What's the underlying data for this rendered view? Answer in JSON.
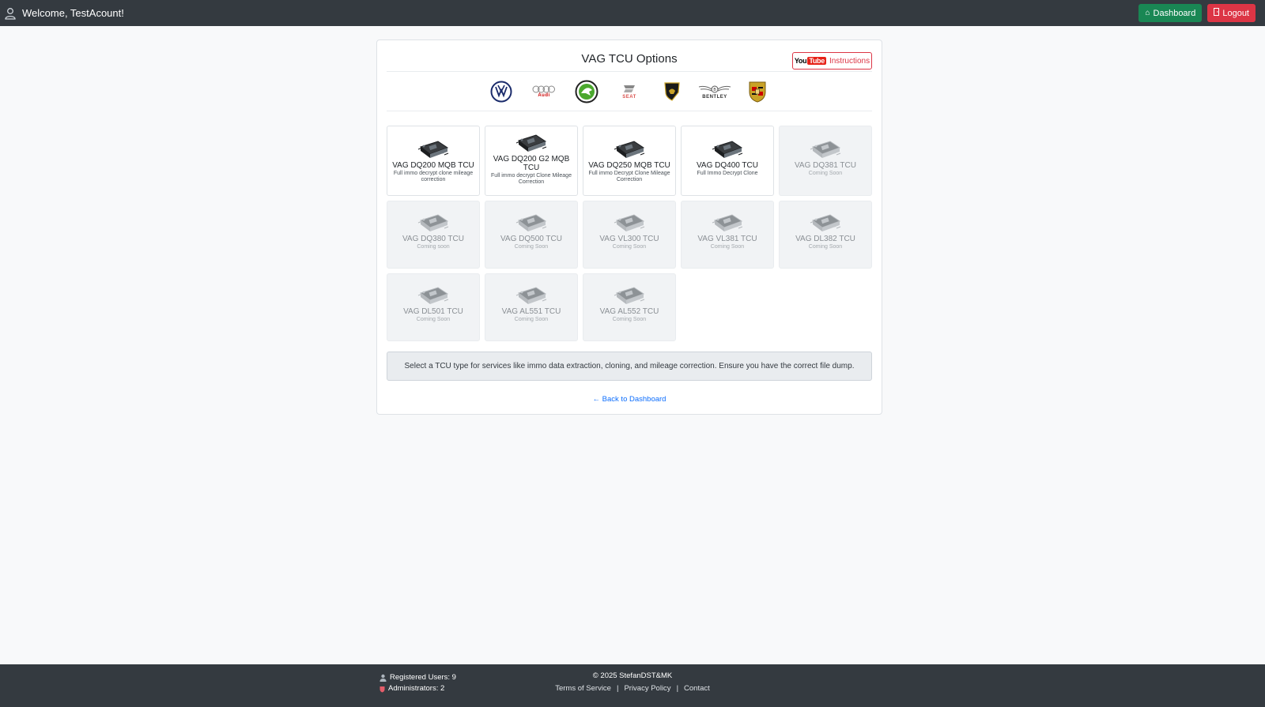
{
  "header": {
    "welcome": "Welcome, TestAcount!",
    "dashboard_label": "Dashboard",
    "logout_label": "Logout"
  },
  "page": {
    "title": "VAG TCU Options",
    "instructions_label": "Instructions",
    "youtube_you": "You",
    "youtube_tube": "Tube",
    "brands": [
      {
        "name": "volkswagen-logo",
        "text": ""
      },
      {
        "name": "audi-logo",
        "text": "Audi"
      },
      {
        "name": "skoda-logo",
        "text": ""
      },
      {
        "name": "seat-logo",
        "text": "SEAT"
      },
      {
        "name": "lamborghini-logo",
        "text": ""
      },
      {
        "name": "bentley-logo",
        "text": "BENTLEY"
      },
      {
        "name": "porsche-logo",
        "text": ""
      }
    ],
    "tiles": [
      {
        "name": "VAG DQ200 MQB TCU",
        "desc": "Full immo decrypt clone mileage correction",
        "enabled": true
      },
      {
        "name": "VAG DQ200 G2 MQB TCU",
        "desc": "Full immo decrypt Clone Mileage Correction",
        "enabled": true
      },
      {
        "name": "VAG DQ250 MQB TCU",
        "desc": "Full immo Decrypt Clone Mileage Correction",
        "enabled": true
      },
      {
        "name": "VAG DQ400 TCU",
        "desc": "Full Immo Decrypt Clone",
        "enabled": true
      },
      {
        "name": "VAG DQ381 TCU",
        "desc": "Coming Soon",
        "enabled": false
      },
      {
        "name": "VAG DQ380 TCU",
        "desc": "Coming soon",
        "enabled": false
      },
      {
        "name": "VAG DQ500 TCU",
        "desc": "Coming Soon",
        "enabled": false
      },
      {
        "name": "VAG VL300 TCU",
        "desc": "Coming Soon",
        "enabled": false
      },
      {
        "name": "VAG VL381 TCU",
        "desc": "Coming Soon",
        "enabled": false
      },
      {
        "name": "VAG DL382 TCU",
        "desc": "Coming Soon",
        "enabled": false
      },
      {
        "name": "VAG DL501 TCU",
        "desc": "Coming Soon",
        "enabled": false
      },
      {
        "name": "VAG AL551 TCU",
        "desc": "Coming Soon",
        "enabled": false
      },
      {
        "name": "VAG AL552 TCU",
        "desc": "Coming Soon",
        "enabled": false
      }
    ],
    "info_text": "Select a TCU type for services like immo data extraction, cloning, and mileage correction. Ensure you have the correct file dump.",
    "back_link": "← Back to Dashboard"
  },
  "footer": {
    "registered_users": "Registered Users: 9",
    "administrators": "Administrators: 2",
    "copyright": "© 2025 StefanDST&MK",
    "links": [
      "Terms of Service",
      "Privacy Policy",
      "Contact"
    ]
  },
  "colors": {
    "header_bg": "#343a40",
    "dashboard_btn": "#198754",
    "logout_btn": "#dc3545",
    "link": "#0d6efd"
  }
}
